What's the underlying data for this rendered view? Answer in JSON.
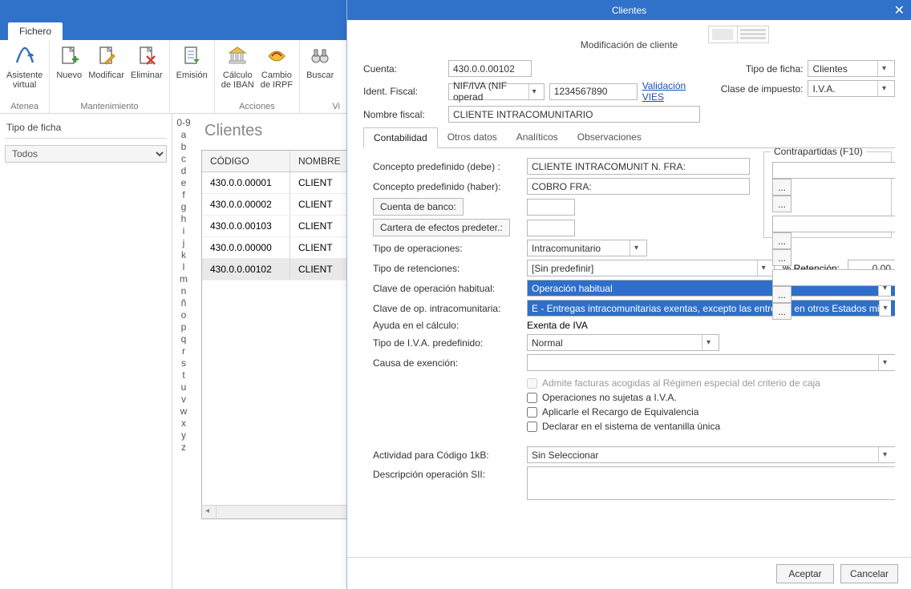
{
  "main": {
    "file_tab": "Fichero",
    "ribbon_groups": {
      "atenea": {
        "title": "Atenea",
        "asistente": "Asistente\nvirtual"
      },
      "mantenimiento": {
        "title": "Mantenimiento",
        "nuevo": "Nuevo",
        "modificar": "Modificar",
        "eliminar": "Eliminar"
      },
      "emision": {
        "title": " ",
        "emision": "Emisión"
      },
      "acciones": {
        "title": "Acciones",
        "calculo": "Cálculo\nde IBAN",
        "cambio": "Cambio\nde IRPF"
      },
      "vista": {
        "title": "Vi",
        "buscar": "Buscar"
      }
    },
    "left": {
      "heading": "Tipo de ficha",
      "select": "Todos"
    },
    "alpha": [
      "0-9",
      "a",
      "b",
      "c",
      "d",
      "e",
      "f",
      "g",
      "h",
      "i",
      "j",
      "k",
      "l",
      "m",
      "n",
      "ñ",
      "o",
      "p",
      "q",
      "r",
      "s",
      "t",
      "u",
      "v",
      "w",
      "x",
      "y",
      "z"
    ],
    "grid": {
      "title": "Clientes",
      "col1": "CÓDIGO",
      "col2": "NOMBRE",
      "rows": [
        {
          "codigo": "430.0.0.00001",
          "nombre": "CLIENT"
        },
        {
          "codigo": "430.0.0.00002",
          "nombre": "CLIENT"
        },
        {
          "codigo": "430.0.0.00103",
          "nombre": "CLIENT"
        },
        {
          "codigo": "430.0.0.00000",
          "nombre": "CLIENT"
        },
        {
          "codigo": "430.0.0.00102",
          "nombre": "CLIENT"
        }
      ],
      "selected_index": 4
    }
  },
  "dialog": {
    "title": "Clientes",
    "subtitle": "Modificación de cliente",
    "top": {
      "cuenta_lbl": "Cuenta:",
      "cuenta_val": "430.0.0.00102",
      "tipo_ficha_lbl": "Tipo de ficha:",
      "tipo_ficha_val": "Clientes",
      "ident_lbl": "Ident. Fiscal:",
      "ident_type": "NIF/IVA (NIF operad",
      "ident_val": "1234567890",
      "valid_vies": "Validación VIES",
      "clase_imp_lbl": "Clase de impuesto:",
      "clase_imp_val": "I.V.A.",
      "nombre_lbl": "Nombre fiscal:",
      "nombre_val": "CLIENTE INTRACOMUNITARIO"
    },
    "tabs": {
      "contabilidad": "Contabilidad",
      "otros": "Otros datos",
      "analiticos": "Analíticos",
      "observaciones": "Observaciones"
    },
    "tab_content": {
      "concepto_debe_lbl": "Concepto predefinido (debe) :",
      "concepto_debe_val": "CLIENTE INTRACOMUNIT N. FRA:",
      "concepto_haber_lbl": "Concepto predefinido (haber):",
      "concepto_haber_val": "COBRO FRA:",
      "cuenta_banco_btn": "Cuenta de banco:",
      "cartera_btn": "Cartera de efectos predeter.:",
      "tipo_op_lbl": "Tipo de operaciones:",
      "tipo_op_val": "Intracomunitario",
      "tipo_ret_lbl": "Tipo de retenciones:",
      "tipo_ret_val": "[Sin predefinir]",
      "pct_ret_lbl": "% Retención:",
      "pct_ret_val": "0,00",
      "clave_op_lbl": "Clave de operación habitual:",
      "clave_op_val": "Operación habitual",
      "clave_intra_lbl": "Clave de op. intracomunitaria:",
      "clave_intra_val": "E - Entregas intracomunitarias exentas, excepto las entregas en otros Estados miembro",
      "ayuda_lbl": "Ayuda en el cálculo:",
      "ayuda_val": "Exenta de IVA",
      "tipo_iva_lbl": "Tipo de I.V.A. predefinido:",
      "tipo_iva_val": "Normal",
      "causa_lbl": "Causa de exención:",
      "chk_caja": "Admite facturas acogidas al Régimen especial del criterio de caja",
      "chk_no_iva": "Operaciones no sujetas a I.V.A.",
      "chk_recargo": "Aplicarle el Recargo de Equivalencia",
      "chk_ventanilla": "Declarar en el sistema de ventanilla única",
      "actividad_lbl": "Actividad para Código 1kB:",
      "actividad_val": "Sin Seleccionar",
      "desc_sii_lbl": "Descripción operación SII:",
      "contrapartidas_title": "Contrapartidas (F10)"
    },
    "footer": {
      "aceptar": "Aceptar",
      "cancelar": "Cancelar"
    }
  }
}
